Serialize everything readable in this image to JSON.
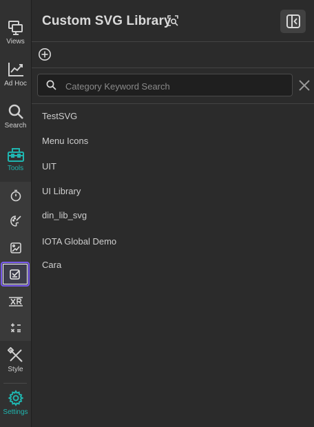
{
  "rail": {
    "views": {
      "label": "Views",
      "icon": "monitor-icon"
    },
    "adhoc": {
      "label": "Ad Hoc",
      "icon": "line-chart-icon"
    },
    "search": {
      "label": "Search",
      "icon": "magnifier-icon"
    },
    "tools": {
      "label": "Tools",
      "icon": "toolbox-icon",
      "color": "#1fb6b0"
    },
    "style": {
      "label": "Style",
      "icon": "brush-pencil-icon"
    },
    "settings": {
      "label": "Settings",
      "icon": "gear-icon",
      "color": "#1fb6b0"
    }
  },
  "tools_submenu": {
    "items": [
      {
        "icon": "stopwatch-icon"
      },
      {
        "icon": "palette-pencil-icon"
      },
      {
        "icon": "image-edit-icon"
      },
      {
        "icon": "svg-library-icon",
        "selected": true,
        "accent": "#7b5cf0"
      },
      {
        "icon": "xr-icon",
        "text": "XR"
      },
      {
        "icon": "calculator-ops-icon"
      }
    ]
  },
  "header": {
    "title": "Custom SVG Library",
    "title_icon": "scan-search-icon",
    "collapse_icon": "collapse-panel-icon"
  },
  "toolbar": {
    "add_icon": "plus-circle-icon"
  },
  "search": {
    "placeholder": "Category Keyword Search",
    "value": ""
  },
  "library": {
    "items": [
      "TestSVG",
      "Menu Icons",
      "UIT",
      "UI Library",
      "din_lib_svg",
      "IOTA Global Demo",
      "Cara"
    ]
  }
}
